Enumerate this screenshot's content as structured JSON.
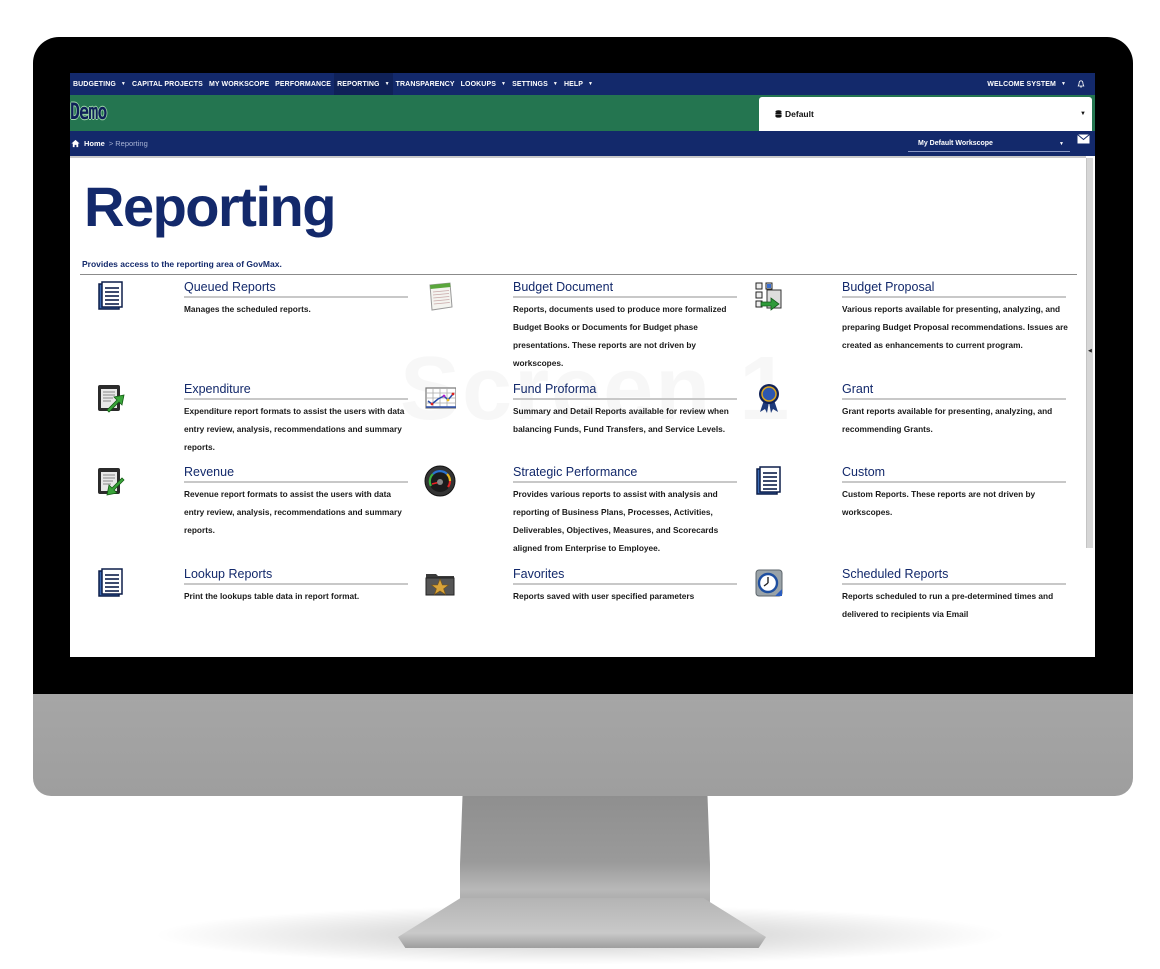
{
  "topnav": {
    "items": [
      {
        "label": "BUDGETING",
        "has_menu": true
      },
      {
        "label": "CAPITAL PROJECTS",
        "has_menu": false
      },
      {
        "label": "MY WORKSCOPE",
        "has_menu": false
      },
      {
        "label": "PERFORMANCE",
        "has_menu": false
      },
      {
        "label": "REPORTING",
        "has_menu": true,
        "active": true
      },
      {
        "label": "TRANSPARENCY",
        "has_menu": false
      },
      {
        "label": "LOOKUPS",
        "has_menu": true
      },
      {
        "label": "SETTINGS",
        "has_menu": true
      },
      {
        "label": "HELP",
        "has_menu": true
      }
    ],
    "caret": "▼",
    "user_label": "WELCOME SYSTEM",
    "bell_icon": "bell-icon"
  },
  "brand": {
    "logo_text": "Demo",
    "database_select": {
      "value": "Default",
      "icon": "database-icon",
      "caret": "▼"
    }
  },
  "breadcrumb": {
    "home_label": "Home",
    "separator": ">",
    "current": "Reporting",
    "workscope_select": {
      "value": "My Default Workscope",
      "caret": "▼"
    },
    "mail_icon": "envelope-icon"
  },
  "page": {
    "title": "Reporting",
    "subtitle": "Provides access to the reporting area of GovMax.",
    "watermark": "Screen 1"
  },
  "tiles": [
    {
      "title": "Queued Reports",
      "icon": "document-list-icon",
      "description": "Manages the scheduled reports."
    },
    {
      "title": "Budget Document",
      "icon": "notepad-icon",
      "description": "Reports, documents used to produce more formalized Budget Books or Documents for Budget phase presentations. These reports are not driven by workscopes."
    },
    {
      "title": "Budget Proposal",
      "icon": "proposal-network-icon",
      "description": "Various reports available for presenting, analyzing, and preparing Budget Proposal recommendations. Issues are created as enhancements to current program."
    },
    {
      "title": "Expenditure",
      "icon": "report-arrow-out-icon",
      "description": "Expenditure report formats to assist the users with data entry review, analysis, recommendations and summary reports."
    },
    {
      "title": "Fund Proforma",
      "icon": "line-chart-icon",
      "description": "Summary and Detail Reports available for review when balancing Funds, Fund Transfers, and Service Levels."
    },
    {
      "title": "Grant",
      "icon": "award-ribbon-icon",
      "description": "Grant reports available for presenting, analyzing, and recommending Grants."
    },
    {
      "title": "Revenue",
      "icon": "report-arrow-in-icon",
      "description": "Revenue report formats to assist the users with data entry review, analysis, recommendations and summary reports."
    },
    {
      "title": "Strategic Performance",
      "icon": "gauge-icon",
      "description": "Provides various reports to assist with analysis and reporting of Business Plans, Processes, Activities, Deliverables, Objectives, Measures, and Scorecards aligned from Enterprise to Employee."
    },
    {
      "title": "Custom",
      "icon": "document-list-icon",
      "description": "Custom Reports. These reports are not driven by workscopes."
    },
    {
      "title": "Lookup Reports",
      "icon": "document-list-icon",
      "description": "Print the lookups table data in report format."
    },
    {
      "title": "Favorites",
      "icon": "star-folder-icon",
      "description": "Reports saved with user specified parameters"
    },
    {
      "title": "Scheduled Reports",
      "icon": "clock-report-icon",
      "description": "Reports scheduled to run a pre-determined times and delivered to recipients via Email"
    }
  ],
  "colors": {
    "nav_blue": "#13296b",
    "brand_green": "#247550",
    "title_blue": "#13296b"
  }
}
